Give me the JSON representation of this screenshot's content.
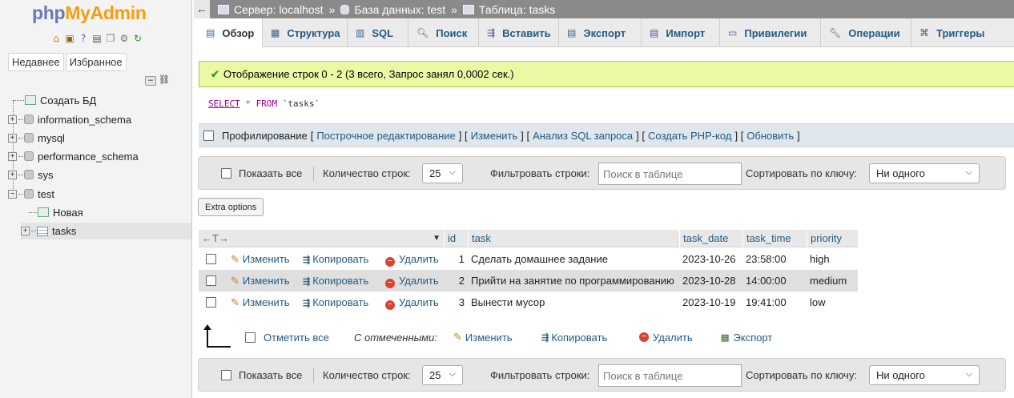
{
  "app": {
    "logo_php": "php",
    "logo_ma": "MyAdmin"
  },
  "nav": {
    "tabs": [
      "Недавнее",
      "Избранное"
    ],
    "icons": [
      "home-icon",
      "exit-icon",
      "help-icon",
      "docs-icon",
      "copy-icon",
      "settings-icon",
      "reload-icon"
    ],
    "tree": {
      "create_db": "Создать БД",
      "databases": [
        "information_schema",
        "mysql",
        "performance_schema",
        "sys",
        "test"
      ],
      "new_table": "Новая",
      "table": "tasks"
    }
  },
  "breadcrumb": {
    "back": "←",
    "server": "Сервер: localhost",
    "database": "База данных: test",
    "table": "Таблица: tasks",
    "separator": "»"
  },
  "tabs": [
    "Обзор",
    "Структура",
    "SQL",
    "Поиск",
    "Вставить",
    "Экспорт",
    "Импорт",
    "Привилегии",
    "Операции",
    "Триггеры"
  ],
  "success_message": "Отображение строк 0 - 2 (3 всего, Запрос занял 0,0002 сек.)",
  "sql": {
    "select": "SELECT",
    "star": "*",
    "from": "FROM",
    "table": "`tasks`"
  },
  "profiling": {
    "label": "Профилирование",
    "links": [
      "Построчное редактирование",
      "Изменить",
      "Анализ SQL запроса",
      "Создать PHP-код",
      "Обновить"
    ]
  },
  "navbar": {
    "show_all": "Показать все",
    "row_count_label": "Количество строк:",
    "row_count_value": "25",
    "filter_label": "Фильтровать строки:",
    "filter_placeholder": "Поиск в таблице",
    "sort_label": "Сортировать по ключу:",
    "sort_value": "Ни одного"
  },
  "extra_options": "Extra options",
  "table": {
    "sort_arrows": "←T→",
    "columns": [
      "id",
      "task",
      "task_date",
      "task_time",
      "priority"
    ],
    "actions": {
      "edit": "Изменить",
      "copy": "Копировать",
      "delete": "Удалить"
    },
    "rows": [
      {
        "id": "1",
        "task": "Сделать домашнее задание",
        "task_date": "2023-10-26",
        "task_time": "23:58:00",
        "priority": "high"
      },
      {
        "id": "2",
        "task": "Прийти на занятие по программированию",
        "task_date": "2023-10-28",
        "task_time": "14:00:00",
        "priority": "medium"
      },
      {
        "id": "3",
        "task": "Вынести мусор",
        "task_date": "2023-10-19",
        "task_time": "19:41:00",
        "priority": "low"
      }
    ]
  },
  "bulk": {
    "check_all": "Отметить все",
    "with_selected": "С отмеченными:",
    "edit": "Изменить",
    "copy": "Копировать",
    "delete": "Удалить",
    "export": "Экспорт"
  },
  "colors": {
    "accent": "#235a81",
    "success_bg": "#ebf8a4",
    "header_bar": "#8a8a8a"
  }
}
